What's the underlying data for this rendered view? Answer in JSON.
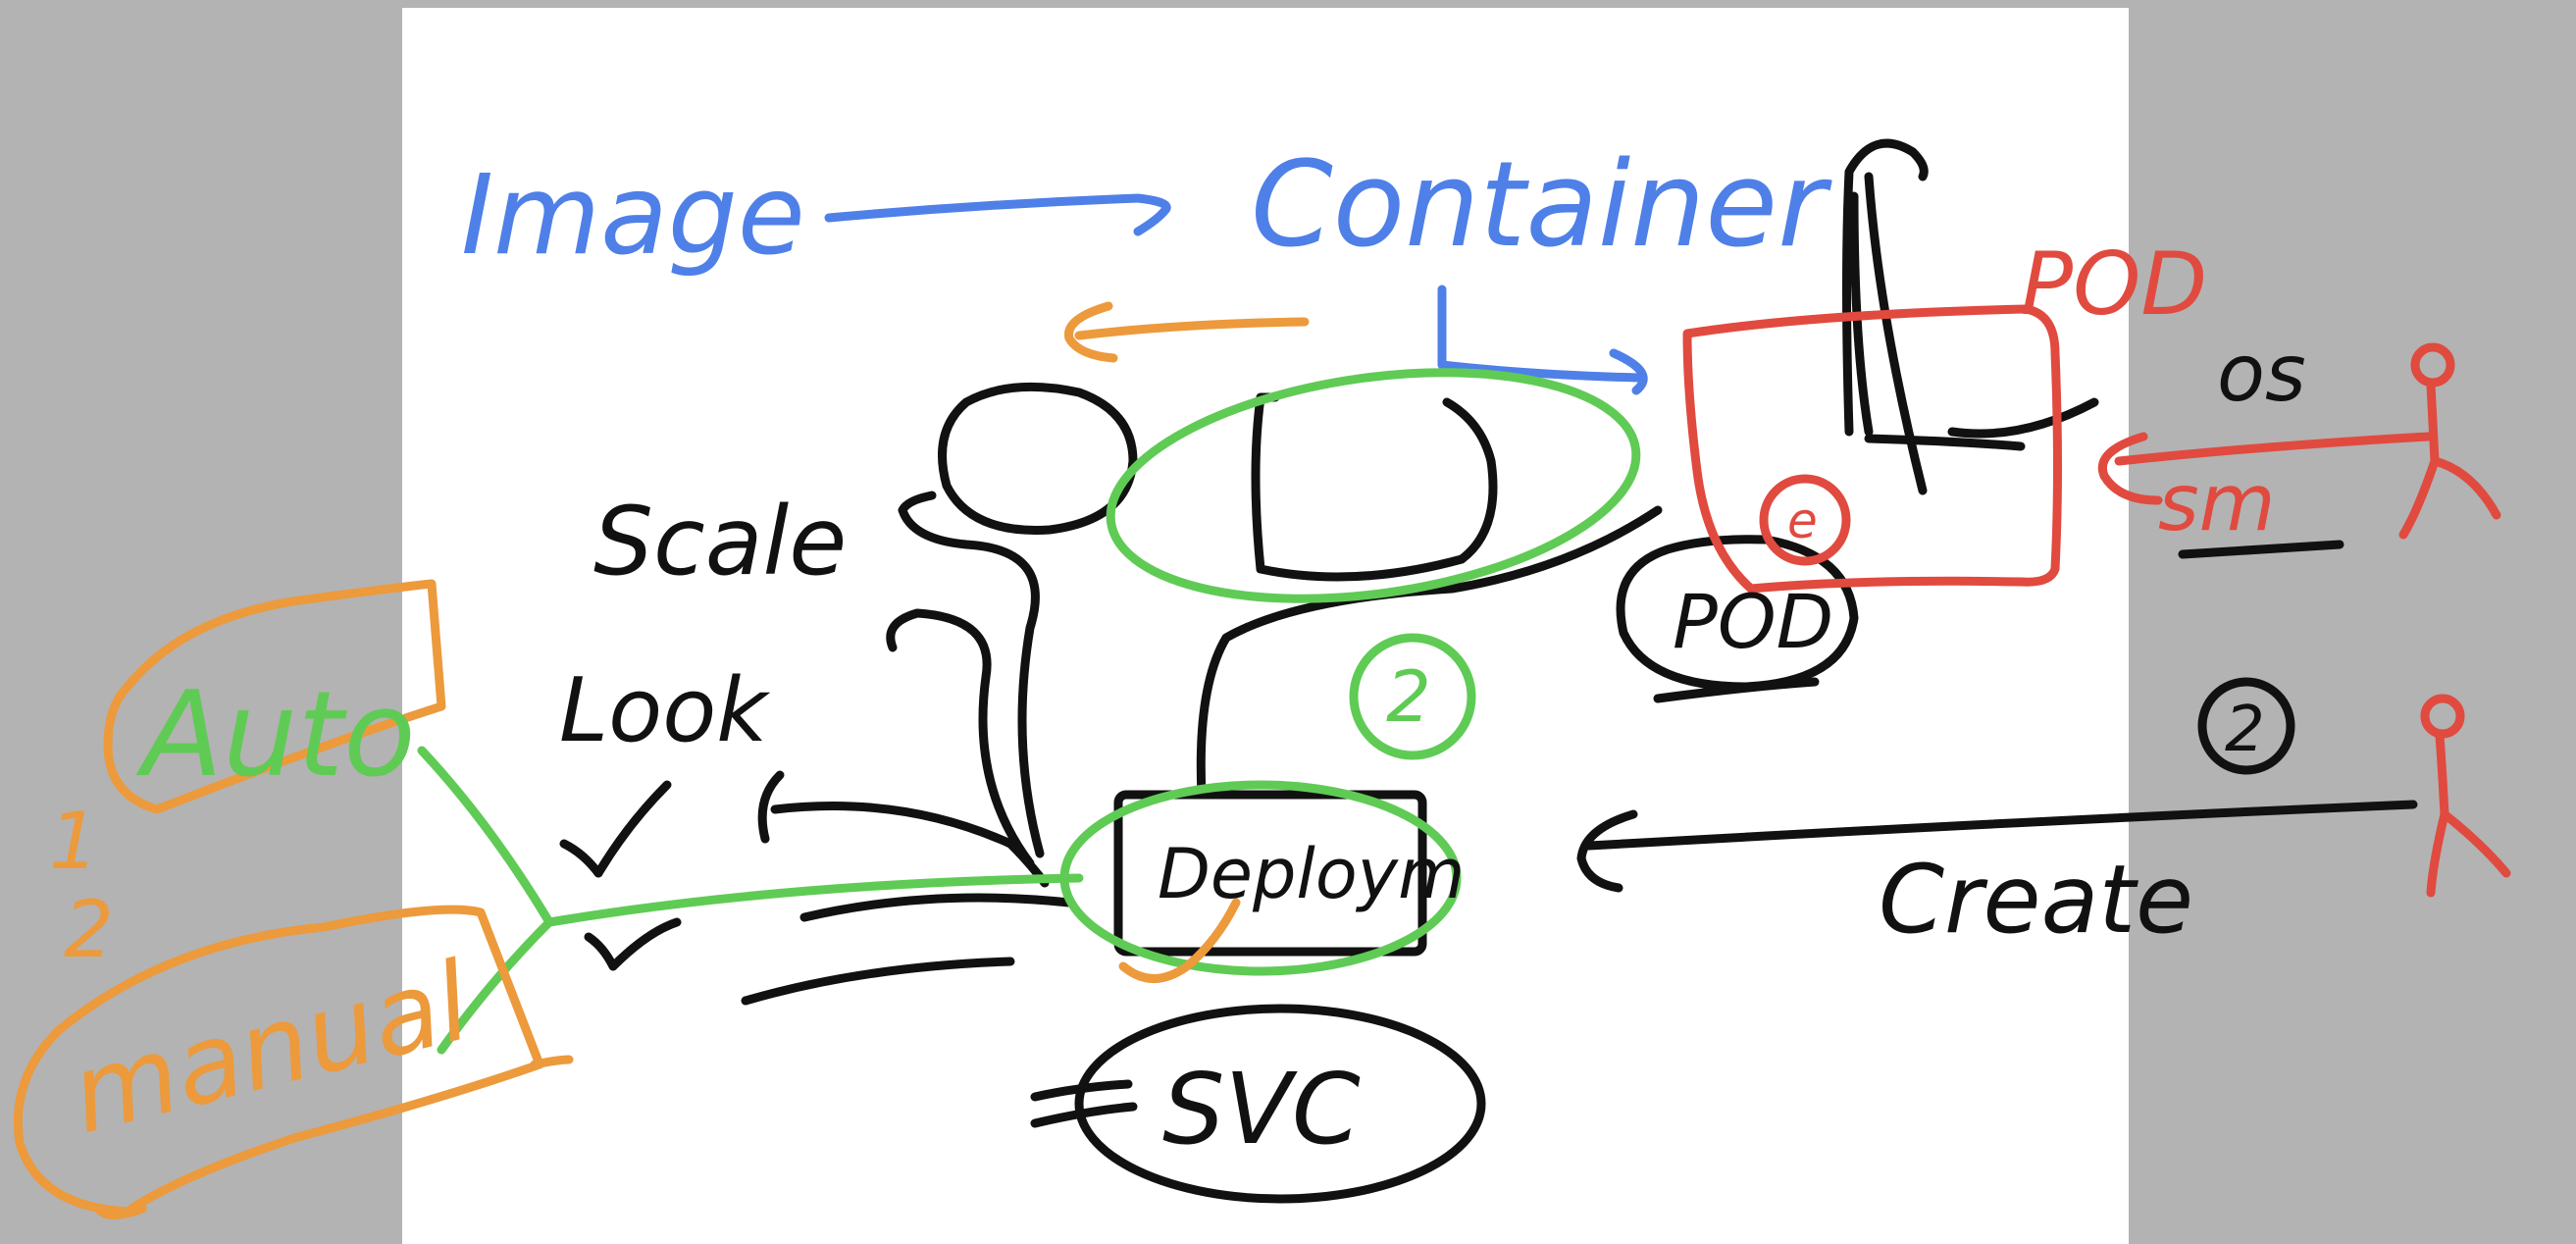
{
  "colors": {
    "backdrop": "#b3b3b3",
    "paper": "#ffffff",
    "black_ink": "#111111",
    "blue_ink": "#4f80e8",
    "orange_ink": "#ec9a3c",
    "green_ink": "#5fcb55",
    "red_ink": "#e14a3f"
  },
  "labels": {
    "image": "Image",
    "container": "Container",
    "pod_red": "POD",
    "pod_black": "POD",
    "os": "os",
    "sm": "sm",
    "scale": "Scale",
    "look": "Look",
    "auto": "Auto",
    "manual": "manual",
    "num_1": "1",
    "num_2": "2",
    "circled_2_green": "2",
    "circled_2_black": "2",
    "circled_red_e": "e",
    "deployment": "Deploym",
    "svc": "SVC",
    "create": "Create"
  },
  "icons": {
    "checkmark": "checkmark-icon",
    "stick_figure": "stick-figure-icon",
    "arrow": "arrow-icon"
  }
}
